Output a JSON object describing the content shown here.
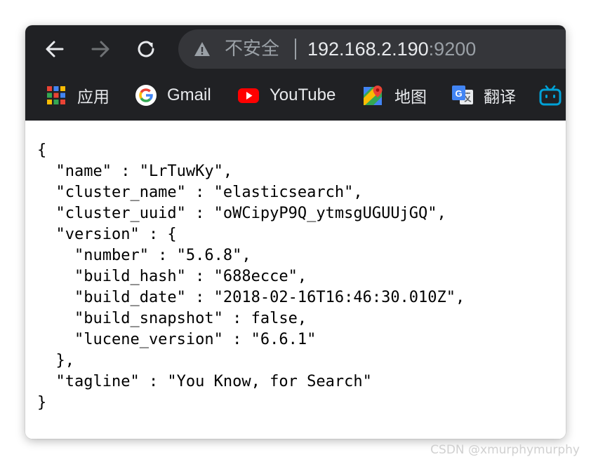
{
  "browser": {
    "omnibox": {
      "security_label": "不安全",
      "url_host": "192.168.2.190",
      "url_port": ":9200"
    },
    "bookmarks": [
      {
        "label": "应用",
        "icon": "apps-grid-icon"
      },
      {
        "label": "Gmail",
        "icon": "google-icon"
      },
      {
        "label": "YouTube",
        "icon": "youtube-icon"
      },
      {
        "label": "地图",
        "icon": "maps-icon"
      },
      {
        "label": "翻译",
        "icon": "translate-icon"
      },
      {
        "label": "",
        "icon": "bilibili-icon"
      }
    ]
  },
  "response_json": "{\n  \"name\" : \"LrTuwKy\",\n  \"cluster_name\" : \"elasticsearch\",\n  \"cluster_uuid\" : \"oWCipyP9Q_ytmsgUGUUjGQ\",\n  \"version\" : {\n    \"number\" : \"5.6.8\",\n    \"build_hash\" : \"688ecce\",\n    \"build_date\" : \"2018-02-16T16:46:30.010Z\",\n    \"build_snapshot\" : false,\n    \"lucene_version\" : \"6.6.1\"\n  },\n  \"tagline\" : \"You Know, for Search\"\n}",
  "watermark": "CSDN @xmurphymurphy",
  "colors": {
    "toolbar_bg": "#202124",
    "omnibox_bg": "#35363a",
    "url_text": "#e8eaed",
    "muted_text": "#9aa0a6"
  }
}
